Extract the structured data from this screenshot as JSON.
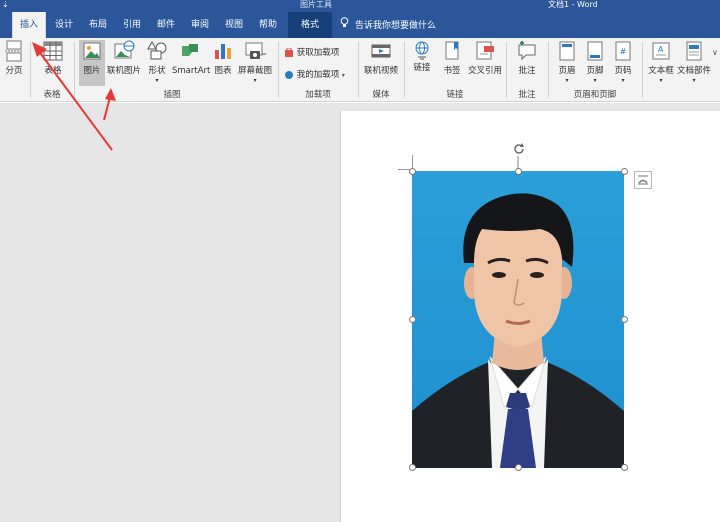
{
  "titlebar": {
    "qat": "⇣",
    "context_title": "图片工具",
    "doc_title": "文档1 - Word"
  },
  "tabs": [
    {
      "label": "插入",
      "active": true
    },
    {
      "label": "设计"
    },
    {
      "label": "布局"
    },
    {
      "label": "引用"
    },
    {
      "label": "邮件"
    },
    {
      "label": "审阅"
    },
    {
      "label": "视图"
    },
    {
      "label": "帮助"
    },
    {
      "label": "格式",
      "contextual": true
    }
  ],
  "tell_me": "告诉我你想要做什么",
  "ribbon": {
    "page_break": "分页",
    "table": "表格",
    "table_group": "表格",
    "picture": "图片",
    "online_picture": "联机图片",
    "shapes": "形状",
    "smartart": "SmartArt",
    "chart": "图表",
    "screenshot": "屏幕截图",
    "illustrations_group": "插图",
    "get_addins": "获取加载项",
    "my_addins": "我的加载项",
    "addins_group": "加载项",
    "online_video": "联机视频",
    "media_group": "媒体",
    "link": "链接",
    "bookmark": "书签",
    "cross_ref": "交叉引用",
    "links_group": "链接",
    "comment": "批注",
    "comments_group": "批注",
    "header": "页眉",
    "footer": "页脚",
    "page_number": "页码",
    "hf_group": "页眉和页脚",
    "textbox": "文本框",
    "doc_parts": "文档部件",
    "more": "∨"
  },
  "colors": {
    "accent": "#2b579a",
    "photo_bg": "#2a9fd8",
    "arrow": "#e53935"
  }
}
